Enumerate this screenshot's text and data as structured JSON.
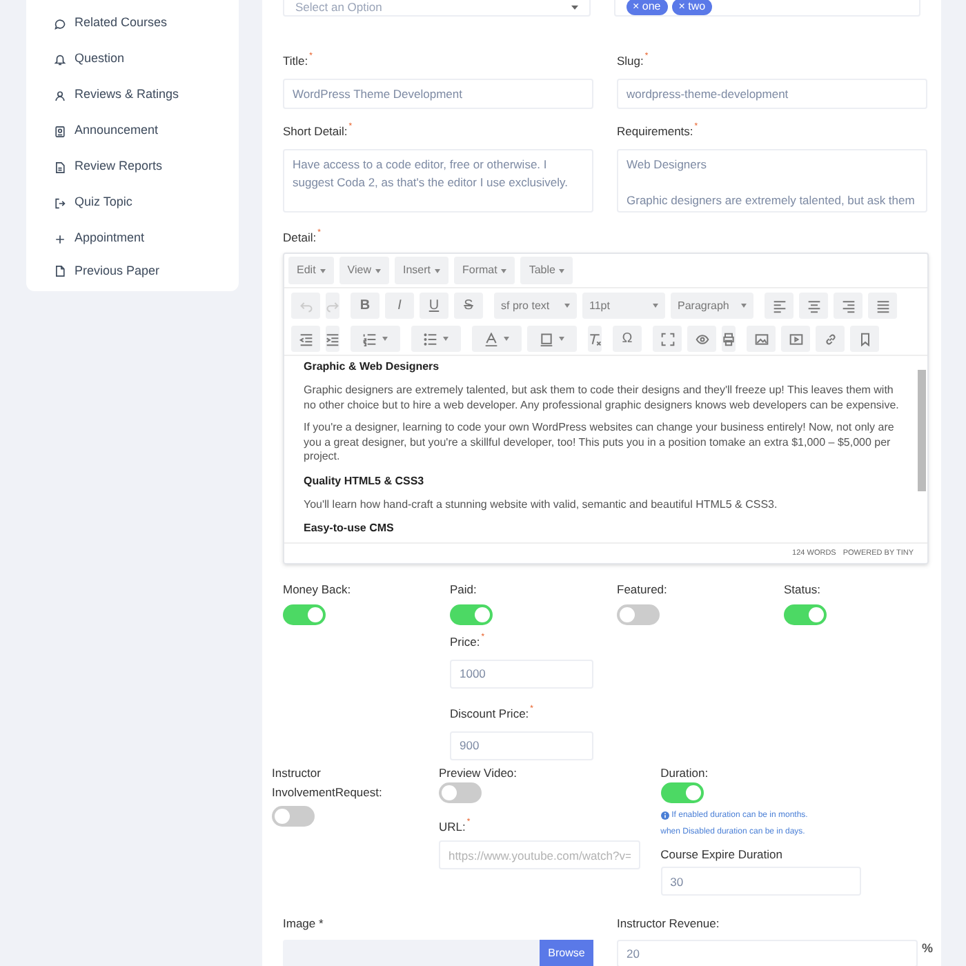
{
  "sidebar": {
    "items": [
      {
        "label": "Related Courses"
      },
      {
        "label": "Question"
      },
      {
        "label": "Reviews & Ratings"
      },
      {
        "label": "Announcement"
      },
      {
        "label": "Review Reports"
      },
      {
        "label": "Quiz Topic"
      },
      {
        "label": "Appointment"
      },
      {
        "label": "Previous Paper"
      }
    ]
  },
  "top": {
    "select_placeholder": "Select an Option",
    "tags": [
      {
        "remove": "×",
        "label": "one"
      },
      {
        "remove": "×",
        "label": "two"
      }
    ]
  },
  "fields_two_col": [
    {
      "label": "Title:",
      "required_mark": "*",
      "kind": "input",
      "value": "WordPress Theme Development"
    },
    {
      "label": "Slug:",
      "required_mark": "*",
      "kind": "input",
      "value": "wordpress-theme-development"
    },
    {
      "label": "Short Detail:",
      "required_mark": "*",
      "kind": "textarea",
      "value": "Have access to a code editor, free or otherwise. I suggest Coda 2, as that's the editor I use exclusively."
    },
    {
      "label": "Requirements:",
      "required_mark": "*",
      "kind": "textarea",
      "value": "Web Designers\n\nGraphic designers are extremely talented, but ask them"
    }
  ],
  "detail": {
    "label": "Detail:",
    "required_mark": "*",
    "menus": [
      "Edit",
      "View",
      "Insert",
      "Format",
      "Table"
    ],
    "format_buttons": [
      "B",
      "I",
      "U",
      "S"
    ],
    "dropdowns": [
      "sf pro text",
      "11pt",
      "Paragraph"
    ],
    "special_char": "Ω",
    "content": [
      {
        "kind": "heading",
        "text": "Graphic & Web Designers"
      },
      {
        "kind": "paragraph",
        "text": "Graphic designers are extremely talented, but ask them to code their designs and they'll freeze up! This leaves them with no other choice but to hire a web developer. Any professional graphic designers knows web developers can be expensive."
      },
      {
        "kind": "paragraph",
        "text": "If you're a designer, learning to code your own WordPress websites can change your business entirely! Now, not only are you a great designer, but you're a skillful developer, too! This puts you in a position tomake an extra $1,000 – $5,000 per project."
      },
      {
        "kind": "heading",
        "text": "Quality HTML5 & CSS3"
      },
      {
        "kind": "paragraph",
        "text": "You'll learn how hand-craft a stunning website with valid, semantic and beautiful HTML5 & CSS3."
      },
      {
        "kind": "heading",
        "text": "Easy-to-use CMS"
      }
    ],
    "word_count": "124 WORDS",
    "powered_by": "POWERED BY TINY"
  },
  "toggles": [
    {
      "label": "Money Back:",
      "on": true
    },
    {
      "label": "Paid:",
      "on": true
    },
    {
      "label": "Featured:",
      "on": false
    },
    {
      "label": "Status:",
      "on": true
    }
  ],
  "price": {
    "label": "Price:",
    "required_mark": "*",
    "value": "1000"
  },
  "discount_price": {
    "label": "Discount Price:",
    "required_mark": "*",
    "value": "900"
  },
  "instructor_involvement": {
    "label_lines": [
      "Instructor",
      "InvolvementRequest:"
    ],
    "on": false
  },
  "preview_video": {
    "label": "Preview Video:",
    "on": false,
    "url_label": "URL:",
    "required_mark": "*",
    "url_placeholder": "https://www.youtube.com/watch?v="
  },
  "duration": {
    "label": "Duration:",
    "on": true,
    "notes": [
      "If enabled duration can be in months.",
      "when Disabled duration can be in days."
    ],
    "expire_label": "Course Expire Duration",
    "expire_value": "30"
  },
  "image": {
    "label": "Image *",
    "button": "Browse"
  },
  "instructor_revenue": {
    "label": "Instructor Revenue:",
    "value": "20",
    "unit": "%"
  }
}
